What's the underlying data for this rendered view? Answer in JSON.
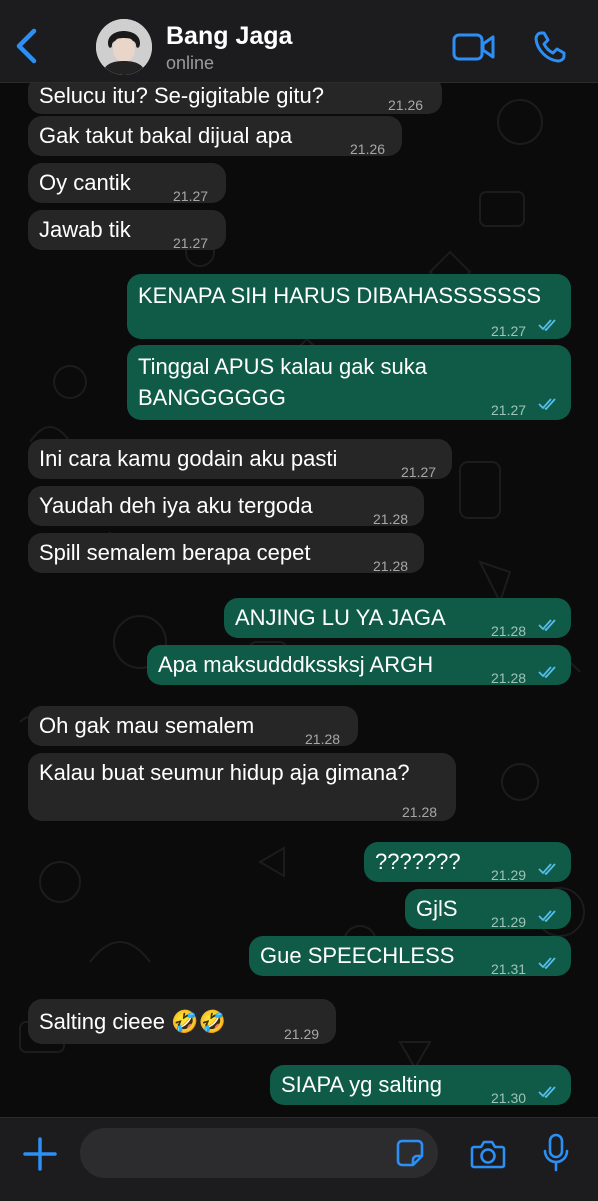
{
  "header": {
    "contact_name": "Bang Jaga",
    "contact_status": "online",
    "icons": [
      "back-chevron-icon",
      "video-call-icon",
      "voice-call-icon"
    ]
  },
  "colors": {
    "accent": "#2b8ff5",
    "incoming_bubble": "#262626",
    "outgoing_bubble": "#0f5b47",
    "read_tick": "#53bdeb"
  },
  "messages": [
    {
      "dir": "in",
      "text": "Selucu itu? Se-gigitable gitu?",
      "time": "21.26"
    },
    {
      "dir": "in",
      "text": "Gak takut bakal dijual apa",
      "time": "21.26"
    },
    {
      "dir": "in",
      "text": "Oy cantik",
      "time": "21.27"
    },
    {
      "dir": "in",
      "text": "Jawab tik",
      "time": "21.27"
    },
    {
      "dir": "out",
      "text": "KENAPA SIH HARUS DIBAHASSSSSSS",
      "time": "21.27"
    },
    {
      "dir": "out",
      "text": "Tinggal APUS kalau gak suka",
      "text2": "BANGGGGGG",
      "time": "21.27"
    },
    {
      "dir": "in",
      "text": "Ini cara kamu godain aku pasti",
      "time": "21.27"
    },
    {
      "dir": "in",
      "text": "Yaudah deh iya aku tergoda",
      "time": "21.28"
    },
    {
      "dir": "in",
      "text": "Spill semalem berapa cepet",
      "time": "21.28"
    },
    {
      "dir": "out",
      "text": "ANJING LU YA JAGA",
      "time": "21.28"
    },
    {
      "dir": "out",
      "text": "Apa maksudddkssksj ARGH",
      "time": "21.28"
    },
    {
      "dir": "in",
      "text": "Oh gak mau semalem",
      "time": "21.28"
    },
    {
      "dir": "in",
      "text": "Kalau buat seumur hidup aja gimana?",
      "time": "21.28"
    },
    {
      "dir": "out",
      "text": "???????",
      "time": "21.29"
    },
    {
      "dir": "out",
      "text": "GjlS",
      "time": "21.29"
    },
    {
      "dir": "out",
      "text": "Gue SPEECHLESS",
      "time": "21.31"
    },
    {
      "dir": "in",
      "text": "Salting cieee 🤣🤣",
      "time": "21.29"
    },
    {
      "dir": "out",
      "text": "SIAPA yg salting",
      "time": "21.30"
    }
  ],
  "footer": {
    "input_placeholder": "",
    "icons": [
      "plus-icon",
      "sticker-icon",
      "camera-icon",
      "microphone-icon"
    ]
  }
}
